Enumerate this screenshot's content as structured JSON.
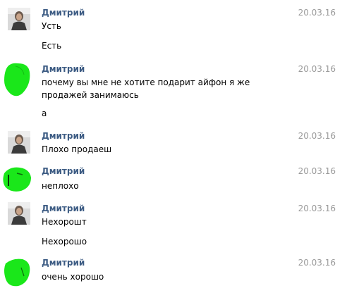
{
  "colors": {
    "name": "#3c5b83",
    "date": "#9a9a9a",
    "scribble": "#1ae71a"
  },
  "messages": [
    {
      "author": "Дмитрий",
      "date": "20.03.16",
      "avatar": "photo-avatar",
      "lines": [
        "Усть",
        "Есть"
      ]
    },
    {
      "author": "Дмитрий",
      "date": "20.03.16",
      "avatar": "green-scribble-avatar",
      "lines": [
        "почему вы мне не хотите подарит айфон я же продажей занимаюсь",
        "а"
      ]
    },
    {
      "author": "Дмитрий",
      "date": "20.03.16",
      "avatar": "photo-avatar",
      "lines": [
        "Плохо продаеш"
      ]
    },
    {
      "author": "Дмитрий",
      "date": "20.03.16",
      "avatar": "green-scribble-avatar",
      "lines": [
        "неплохо"
      ]
    },
    {
      "author": "Дмитрий",
      "date": "20.03.16",
      "avatar": "photo-avatar",
      "lines": [
        "Нехорошт",
        "Нехорошо"
      ]
    },
    {
      "author": "Дмитрий",
      "date": "20.03.16",
      "avatar": "green-scribble-avatar",
      "lines": [
        "очень хорошо"
      ]
    }
  ]
}
